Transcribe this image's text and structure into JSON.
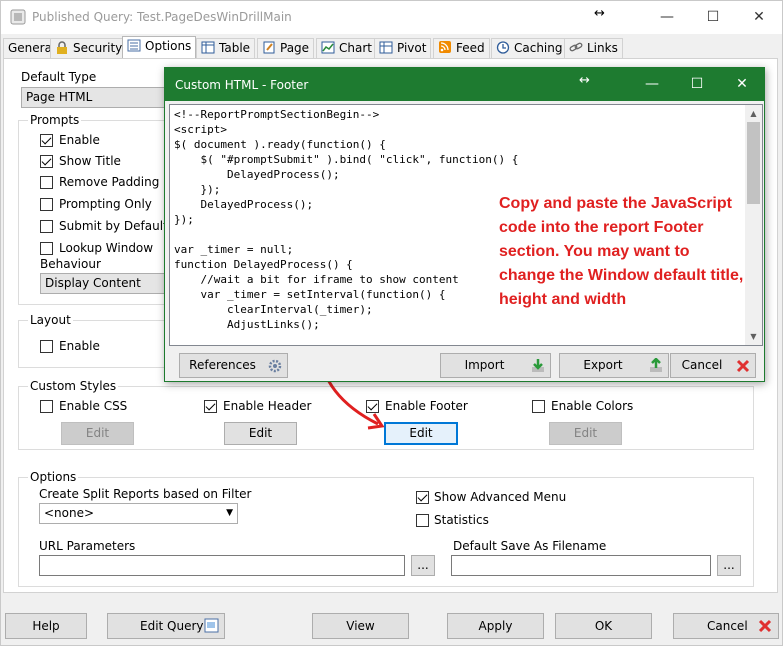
{
  "window": {
    "title": "Published Query: Test.PageDesWinDrillMain"
  },
  "tabs": [
    {
      "label": "General"
    },
    {
      "label": "Security"
    },
    {
      "label": "Options"
    },
    {
      "label": "Table"
    },
    {
      "label": "Page"
    },
    {
      "label": "Chart"
    },
    {
      "label": "Pivot"
    },
    {
      "label": "Feed"
    },
    {
      "label": "Caching"
    },
    {
      "label": "Links"
    }
  ],
  "options": {
    "default_type_label": "Default Type",
    "default_type_value": "Page HTML",
    "prompts_title": "Prompts",
    "prompts": [
      {
        "label": "Enable",
        "checked": true
      },
      {
        "label": "Show Title",
        "checked": true
      },
      {
        "label": "Remove Padding",
        "checked": false
      },
      {
        "label": "Prompting Only",
        "checked": false
      },
      {
        "label": "Submit by Default",
        "checked": false
      },
      {
        "label": "Lookup Window",
        "checked": false
      }
    ],
    "behaviour_label": "Behaviour",
    "behaviour_value": "Display Content",
    "layout_title": "Layout",
    "layout_enable": "Enable",
    "custom_styles_title": "Custom Styles",
    "styles": [
      {
        "label": "Enable CSS",
        "checked": false,
        "edit": "Edit"
      },
      {
        "label": "Enable Header",
        "checked": true,
        "edit": "Edit"
      },
      {
        "label": "Enable Footer",
        "checked": true,
        "edit": "Edit"
      },
      {
        "label": "Enable Colors",
        "checked": false,
        "edit": "Edit"
      }
    ],
    "options_title": "Options",
    "split_label": "Create Split Reports based on Filter",
    "split_value": "<none>",
    "show_adv_menu": "Show Advanced Menu",
    "statistics": "Statistics",
    "url_params_label": "URL Parameters",
    "default_save_label": "Default Save As Filename",
    "ellipsis": "..."
  },
  "bottom": {
    "help": "Help",
    "edit_query": "Edit Query",
    "view": "View",
    "apply": "Apply",
    "ok": "OK",
    "cancel": "Cancel"
  },
  "dialog": {
    "title": "Custom HTML - Footer",
    "code": "<!--ReportPromptSectionBegin-->\n<script>\n$( document ).ready(function() {\n    $( \"#promptSubmit\" ).bind( \"click\", function() {\n        DelayedProcess();\n    });\n    DelayedProcess();\n});\n\nvar _timer = null;\nfunction DelayedProcess() {\n    //wait a bit for iframe to show content\n    var _timer = setInterval(function() {\n        clearInterval(_timer);\n        AdjustLinks();",
    "callout": "Copy and paste the JavaScript code into the report Footer section.  You may want to change the Window default title, height and width",
    "references": "References",
    "import": "Import",
    "export": "Export",
    "cancel": "Cancel"
  },
  "colors": {
    "dialog_title_bg": "#1e7b30",
    "callout": "#e02020",
    "arrow": "#e02020",
    "focus": "#0078d7"
  }
}
